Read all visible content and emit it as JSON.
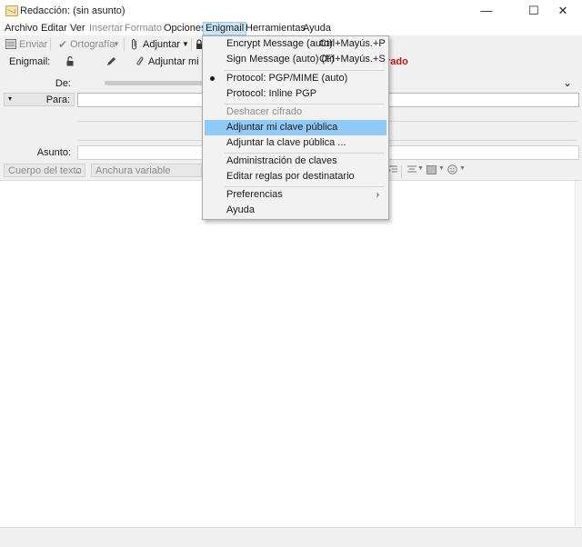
{
  "window": {
    "title": "Redacción: (sin asunto)",
    "minimize": "—",
    "maximize": "☐",
    "close": "✕"
  },
  "menubar": [
    "Archivo",
    "Editar",
    "Ver",
    "Insertar",
    "Formato",
    "Opciones",
    "Enigmail",
    "Herramientas",
    "Ayuda"
  ],
  "toolbar": {
    "send": "Enviar",
    "spelling": "Ortografía",
    "attach": "Adjuntar"
  },
  "enigmail_bar": {
    "label": "Enigmail:",
    "attach_key": "Adjuntar mi cla",
    "status_fragment": "rado"
  },
  "headers": {
    "from_label": "De:",
    "to_dropdown": "Para:",
    "subject_label": "Asunto:"
  },
  "formatbar": {
    "paragraph": "Cuerpo del texto",
    "font": "Anchura variable"
  },
  "enigmail_menu": {
    "items": [
      {
        "label": "Encrypt Message (auto)",
        "shortcut": "Ctrl+Mayús.+P"
      },
      {
        "label": "Sign Message (auto) (F)",
        "shortcut": "Ctrl+Mayús.+S"
      },
      {
        "label": "Protocol: PGP/MIME (auto)",
        "checked": true
      },
      {
        "label": "Protocol: Inline PGP"
      },
      {
        "label": "Deshacer cifrado",
        "disabled": true
      },
      {
        "label": "Adjuntar mi clave pública",
        "highlighted": true
      },
      {
        "label": "Adjuntar la clave pública ..."
      },
      {
        "label": "Administración de claves"
      },
      {
        "label": "Editar reglas por destinatario"
      },
      {
        "label": "Preferencias",
        "submenu": true
      },
      {
        "label": "Ayuda"
      }
    ]
  },
  "colors": {
    "highlight": "#91c9f7",
    "menu_active": "#cce4f7",
    "status_red": "#d01010"
  }
}
